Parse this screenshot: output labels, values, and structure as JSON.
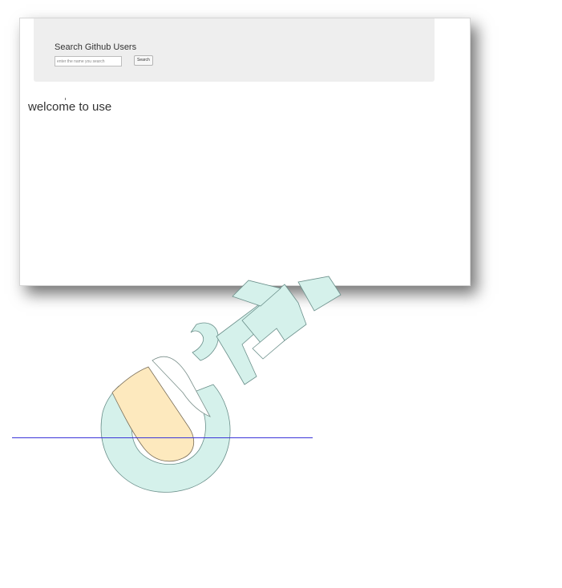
{
  "app": {
    "title": "Search Github Users"
  },
  "search": {
    "placeholder": "enter the name you search",
    "button_label": "Search"
  },
  "main": {
    "message": "welcome to use"
  },
  "colors": {
    "jumbotron_bg": "#eeeeee",
    "text": "#333333",
    "line": "#3b35d9",
    "watermark_teal": "#d5f1eb",
    "watermark_yellow": "#fde9be"
  },
  "icons": {
    "watermark": "logo-watermark-icon"
  }
}
